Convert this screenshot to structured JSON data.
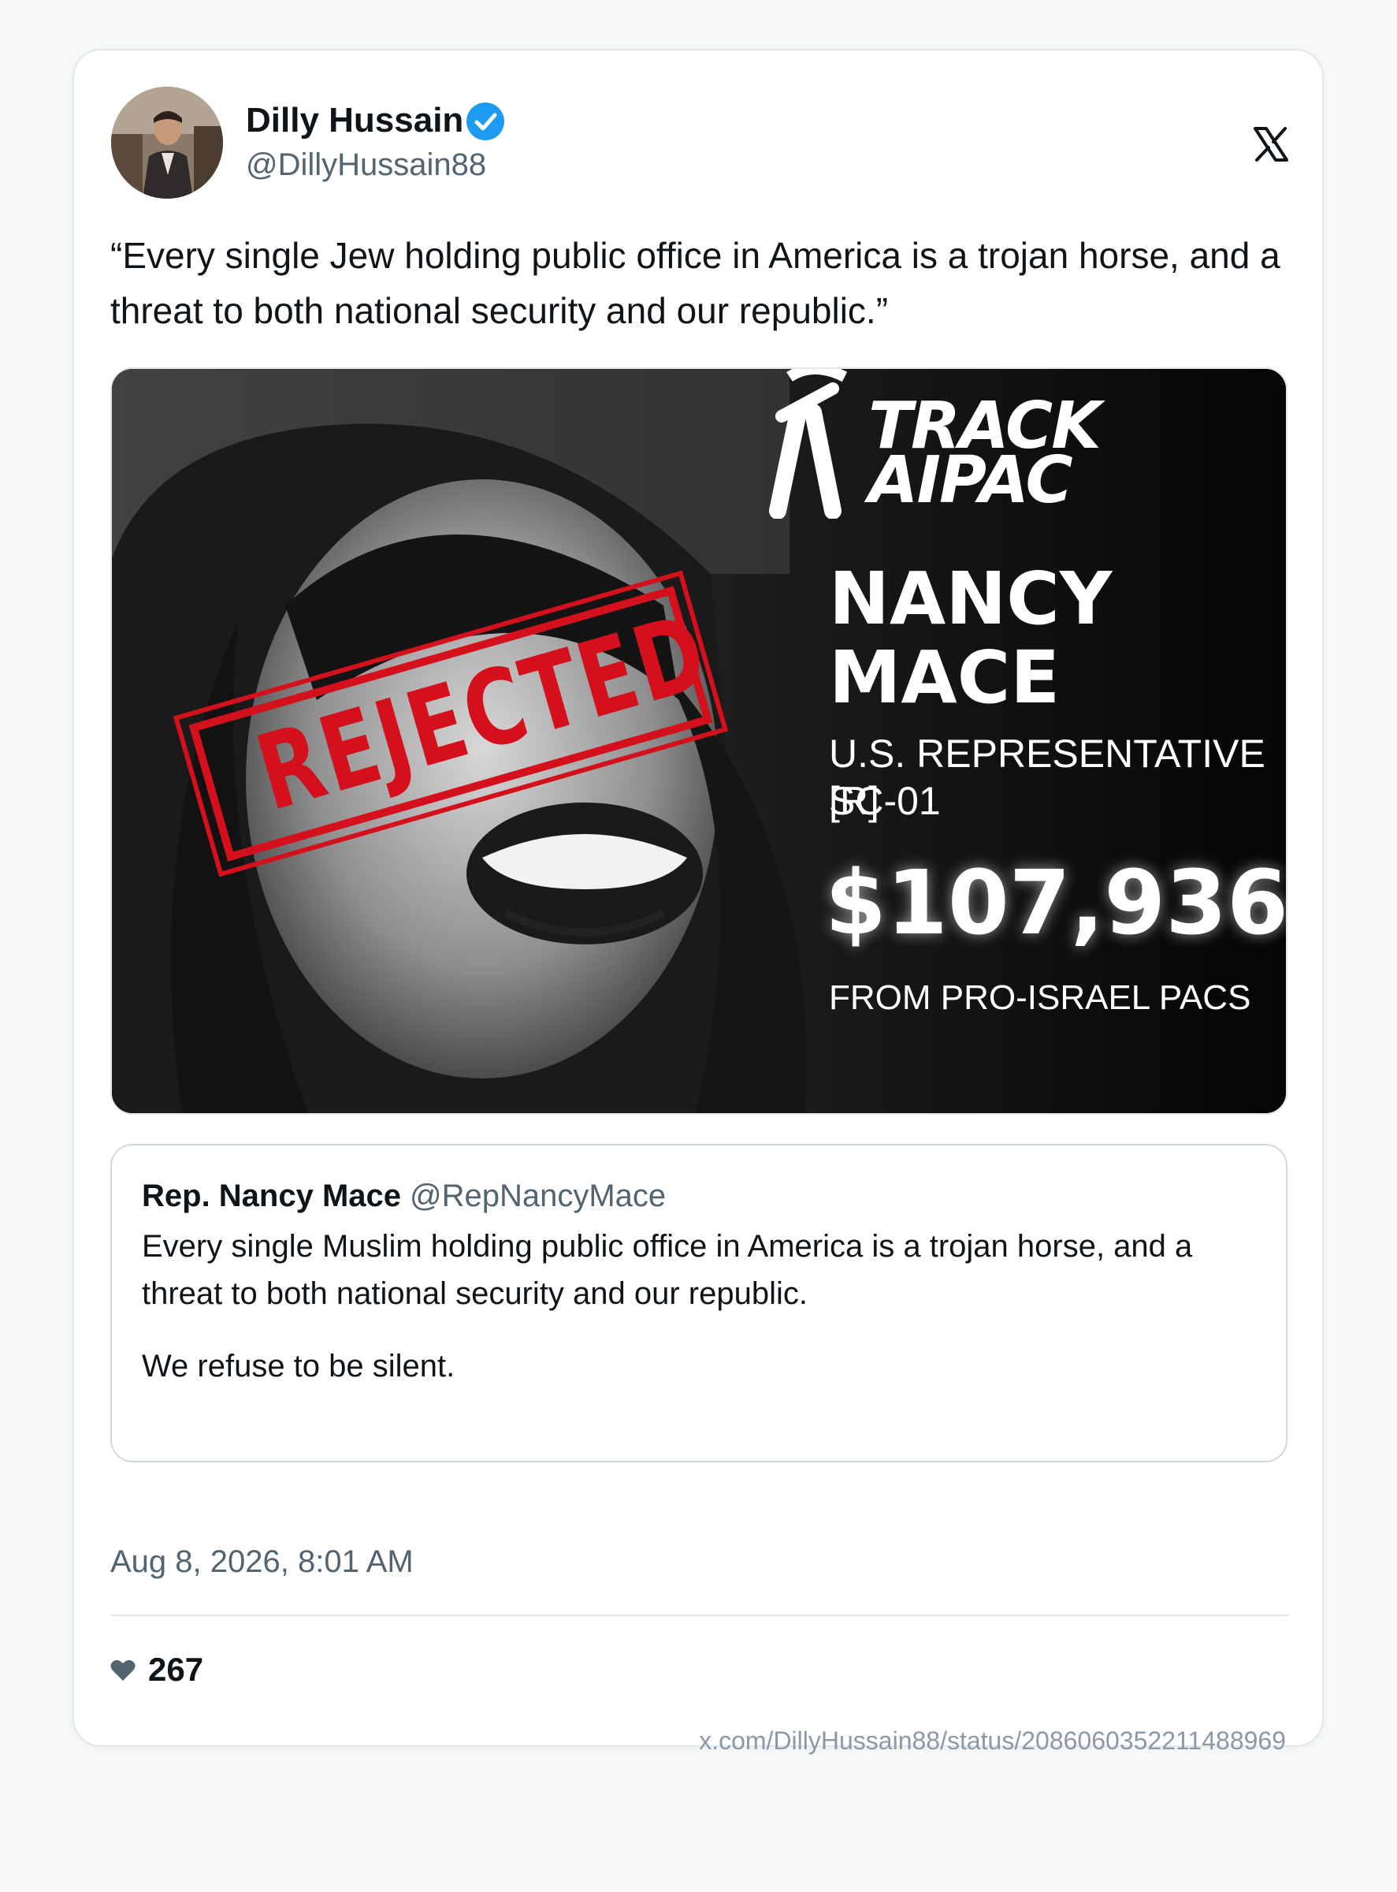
{
  "author": {
    "name": "Dilly Hussain",
    "handle": "@DillyHussain88",
    "verified": true
  },
  "platform_logo": "x-logo",
  "tweet": {
    "text": "“Every single Jew holding public office in America is a trojan horse, and a threat to both national security and our republic.”"
  },
  "media": {
    "brand_line1": "TRACK",
    "brand_line2": "AIPAC",
    "stamp": "REJECTED",
    "name_line1": "NANCY",
    "name_line2": "MACE",
    "office_line1": "U.S. REPRESENTATIVE [R]",
    "office_line2": "SC-01",
    "amount": "$107,936",
    "source": "FROM PRO-ISRAEL PACS"
  },
  "quote": {
    "name": "Rep. Nancy Mace",
    "handle": "@RepNancyMace",
    "text": "Every single Muslim holding public office in America is a trojan horse, and a threat to both national security and our republic.",
    "text2": "We refuse to be silent."
  },
  "timestamp": "Aug 8, 2026, 8:01 AM",
  "likes": "267",
  "url": "x.com/DillyHussain88/status/2086060352211488969",
  "colors": {
    "verified_blue": "#1d9bf0",
    "stamp_red": "#d4101c",
    "secondary_text": "#536471"
  }
}
